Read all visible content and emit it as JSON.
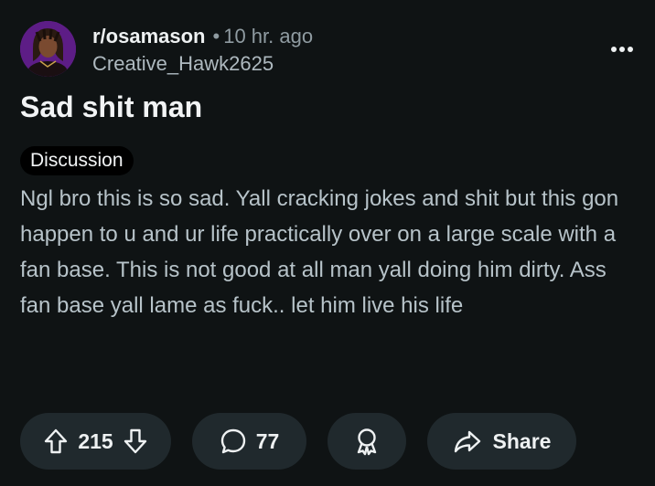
{
  "header": {
    "subreddit": "r/osamason",
    "separator": "•",
    "time_ago": "10 hr. ago",
    "username": "Creative_Hawk2625"
  },
  "post": {
    "title": "Sad shit man",
    "flair": "Discussion",
    "body": "Ngl bro this is so sad. Yall cracking jokes and shit but this gon happen to u and ur life practically over on a large scale with a fan base. This is not good at all man yall doing him dirty. Ass fan base yall lame as fuck.. let him live his life"
  },
  "actions": {
    "votes": "215",
    "comments": "77",
    "share_label": "Share"
  },
  "icons": {
    "more": "more-dots-icon",
    "upvote": "upvote-arrow-icon",
    "downvote": "downvote-arrow-icon",
    "comment": "comment-bubble-icon",
    "award": "award-icon",
    "share": "share-arrow-icon"
  },
  "colors": {
    "background": "#0f1314",
    "pill": "#20292d",
    "avatar_bg": "#5d1d86",
    "body_text": "#b7c3c9",
    "meta_text": "#8f9ba1"
  }
}
